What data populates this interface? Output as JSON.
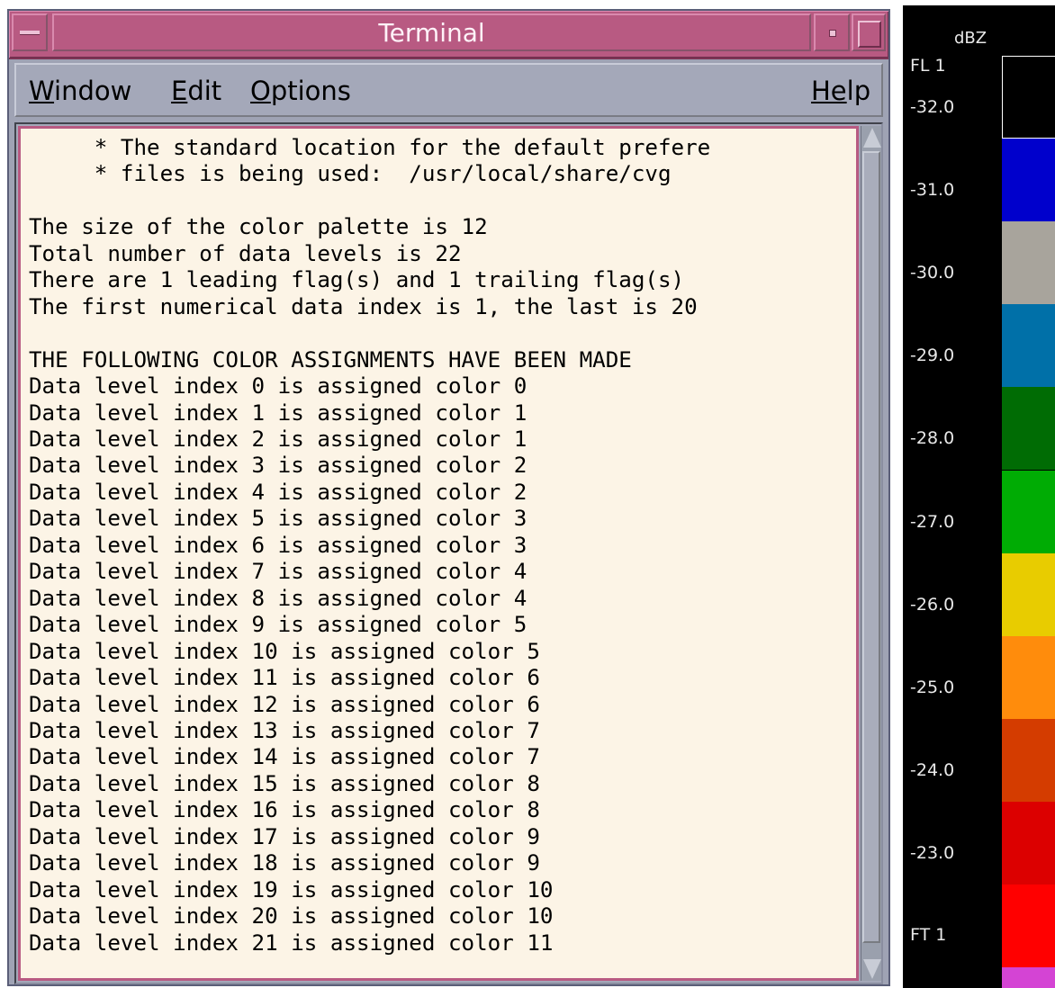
{
  "window": {
    "title": "Terminal",
    "icons": {
      "window_menu": "window-menu-icon",
      "minimize": "minimize-icon",
      "maximize": "maximize-icon"
    }
  },
  "menubar": {
    "window": {
      "mnemonic": "W",
      "rest": "indow"
    },
    "edit": {
      "mnemonic": "E",
      "rest": "dit"
    },
    "options": {
      "mnemonic": "O",
      "rest": "ptions"
    },
    "help": {
      "mnemonic": "He",
      "rest": "lp"
    }
  },
  "terminal": {
    "lines": [
      "     * The standard location for the default prefere",
      "     * files is being used:  /usr/local/share/cvg",
      "",
      "The size of the color palette is 12",
      "Total number of data levels is 22",
      "There are 1 leading flag(s) and 1 trailing flag(s)",
      "The first numerical data index is 1, the last is 20",
      "",
      "THE FOLLOWING COLOR ASSIGNMENTS HAVE BEEN MADE",
      "Data level index 0 is assigned color 0",
      "Data level index 1 is assigned color 1",
      "Data level index 2 is assigned color 1",
      "Data level index 3 is assigned color 2",
      "Data level index 4 is assigned color 2",
      "Data level index 5 is assigned color 3",
      "Data level index 6 is assigned color 3",
      "Data level index 7 is assigned color 4",
      "Data level index 8 is assigned color 4",
      "Data level index 9 is assigned color 5",
      "Data level index 10 is assigned color 5",
      "Data level index 11 is assigned color 6",
      "Data level index 12 is assigned color 6",
      "Data level index 13 is assigned color 7",
      "Data level index 14 is assigned color 7",
      "Data level index 15 is assigned color 8",
      "Data level index 16 is assigned color 8",
      "Data level index 17 is assigned color 9",
      "Data level index 18 is assigned color 9",
      "Data level index 19 is assigned color 10",
      "Data level index 20 is assigned color 10",
      "Data level index 21 is assigned color 11"
    ]
  },
  "legend": {
    "unit": "dBZ",
    "labels": [
      "FL 1",
      "-32.0",
      "-31.0",
      "-30.0",
      "-29.0",
      "-28.0",
      "-27.0",
      "-26.0",
      "-25.0",
      "-24.0",
      "-23.0",
      "FT 1"
    ],
    "colors": [
      "#000000",
      "#0000cc",
      "#a8a49c",
      "#0070a8",
      "#006c04",
      "#00ac04",
      "#e8cc00",
      "#ff8c0c",
      "#d43c00",
      "#dc0000",
      "#ff0000",
      "#d444d4"
    ]
  }
}
